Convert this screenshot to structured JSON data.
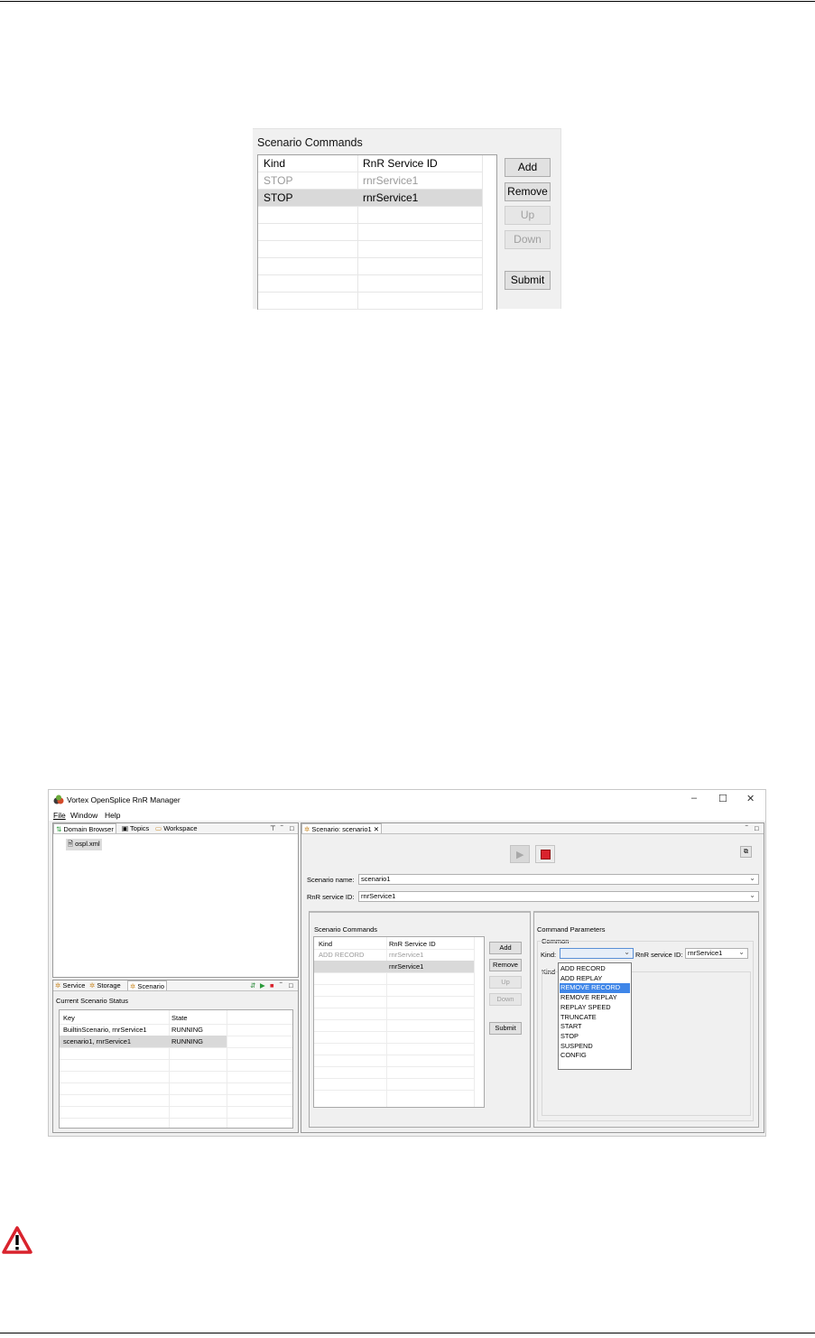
{
  "figure1": {
    "title": "Scenario Commands",
    "columns": [
      "Kind",
      "RnR Service ID"
    ],
    "rows": [
      {
        "kind": "STOP",
        "service": "rnrService1",
        "state": "dimmed"
      },
      {
        "kind": "STOP",
        "service": "rnrService1",
        "state": "selected"
      }
    ],
    "buttons": {
      "add": "Add",
      "remove": "Remove",
      "up": "Up",
      "down": "Down",
      "submit": "Submit"
    }
  },
  "window": {
    "title": "Vortex OpenSplice RnR Manager",
    "controls": {
      "minimize": "–",
      "maximize": "☐",
      "close": "✕"
    },
    "menu": {
      "file": "File",
      "window": "Window",
      "help": "Help"
    },
    "left_top": {
      "tabs": {
        "domain_browser": "Domain Browser",
        "topics": "Topics",
        "workspace": "Workspace"
      },
      "tree_item": "ospl.xml"
    },
    "left_bottom": {
      "tabs": {
        "service": "Service",
        "storage": "Storage",
        "scenario": "Scenario"
      },
      "status_title": "Current Scenario Status",
      "columns": [
        "Key",
        "State"
      ],
      "rows": [
        {
          "key": "BuiltinScenario, rnrService1",
          "state": "RUNNING"
        },
        {
          "key": "scenario1, rnrService1",
          "state": "RUNNING"
        }
      ]
    },
    "editor": {
      "tab": "Scenario: scenario1",
      "scenario_name_label": "Scenario name:",
      "scenario_name_value": "scenario1",
      "rnr_service_label": "RnR service ID:",
      "rnr_service_value": "rnrService1",
      "commands": {
        "title": "Scenario Commands",
        "columns": [
          "Kind",
          "RnR Service ID"
        ],
        "rows": [
          {
            "kind": "ADD RECORD",
            "service": "rnrService1",
            "state": "dimmed"
          },
          {
            "kind": "",
            "service": "rnrService1",
            "state": "selected"
          }
        ],
        "buttons": {
          "add": "Add",
          "remove": "Remove",
          "up": "Up",
          "down": "Down",
          "submit": "Submit"
        }
      },
      "params": {
        "title": "Command Parameters",
        "group": "Common",
        "kind_label": "Kind:",
        "kind_value": "",
        "rnr_label": "RnR service ID:",
        "rnr_value": "rnrService1",
        "kind_group_label": "Kind",
        "options": [
          "ADD RECORD",
          "ADD REPLAY",
          "REMOVE RECORD",
          "REMOVE REPLAY",
          "REPLAY SPEED",
          "TRUNCATE",
          "START",
          "STOP",
          "SUSPEND",
          "CONFIG"
        ],
        "selected_option": "REMOVE RECORD"
      }
    }
  },
  "warning_icon": "warning-triangle-icon",
  "colors": {
    "selection": "#3f86e8",
    "stop_red": "#d9232d",
    "warning_red": "#d9232d"
  }
}
